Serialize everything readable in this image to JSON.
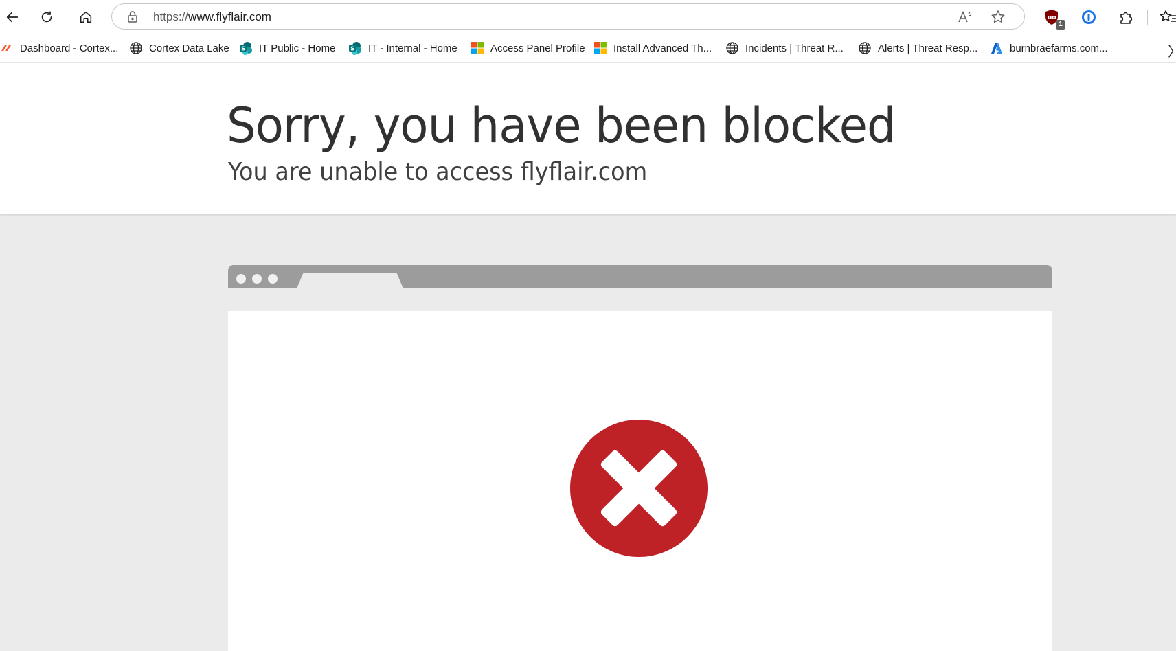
{
  "browser": {
    "url_scheme": "https://",
    "url_host": "www.flyflair.com",
    "extension_badge": "1",
    "bookmarks": [
      {
        "label": "Dashboard - Cortex...",
        "icon": "cortex-icon"
      },
      {
        "label": "Cortex Data Lake",
        "icon": "globe-icon"
      },
      {
        "label": "IT Public - Home",
        "icon": "sharepoint-icon"
      },
      {
        "label": "IT - Internal - Home",
        "icon": "sharepoint-icon"
      },
      {
        "label": "Access Panel Profile",
        "icon": "microsoft-icon"
      },
      {
        "label": "Install Advanced Th...",
        "icon": "microsoft-icon"
      },
      {
        "label": "Incidents | Threat R...",
        "icon": "globe-icon"
      },
      {
        "label": "Alerts | Threat Resp...",
        "icon": "globe-icon"
      },
      {
        "label": "burnbraefarms.com...",
        "icon": "azure-icon"
      }
    ],
    "bookmarks_overflow": "〉"
  },
  "page": {
    "title": "Sorry, you have been blocked",
    "subtitle": "You are unable to access flyflair.com"
  },
  "colors": {
    "error_red": "#be2126",
    "frame_gray": "#9c9c9c",
    "page_gray": "#ebebeb"
  }
}
